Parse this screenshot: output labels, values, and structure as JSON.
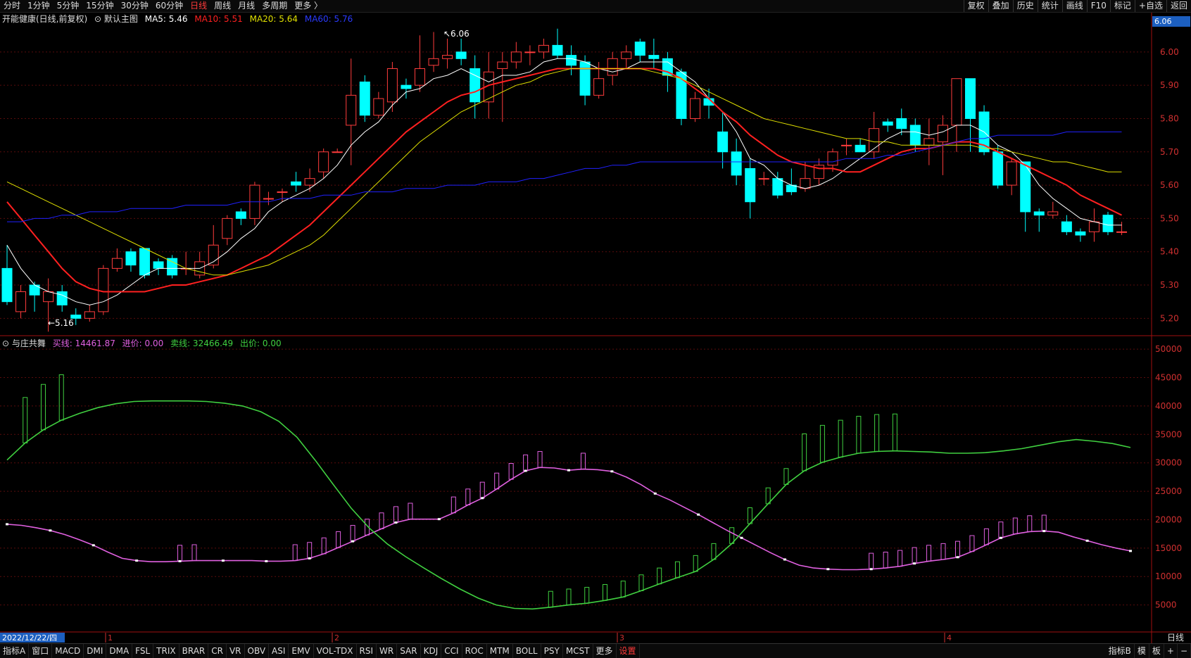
{
  "toolbar": {
    "periods": [
      "分时",
      "1分钟",
      "5分钟",
      "15分钟",
      "30分钟",
      "60分钟",
      "日线",
      "周线",
      "月线",
      "多周期",
      "更多 〉"
    ],
    "active_index": 6,
    "right_items": [
      "复权",
      "叠加",
      "历史",
      "统计",
      "画线",
      "F10",
      "标记",
      "+自选",
      "返回"
    ]
  },
  "main_legend": {
    "title": "开能健康(日线,前复权)",
    "template": "默认主图",
    "ma5": "MA5: 5.46",
    "ma10": "MA10: 5.51",
    "ma20": "MA20: 5.64",
    "ma60": "MA60: 5.76"
  },
  "indicator_legend": {
    "name": "与庄共舞",
    "buy": "买线: 14461.87",
    "in_price": "进价: 0.00",
    "sell": "卖线: 32466.49",
    "out_price": "出价: 0.00"
  },
  "annotations": {
    "high": "6.06",
    "low": "5.16",
    "current_price": "6.06",
    "date_label": "2022/12/22/四"
  },
  "colors": {
    "up": "#ff3c3c",
    "down": "#00ffff",
    "ma5": "#ffffff",
    "ma10": "#ff2020",
    "ma20": "#e0e000",
    "ma60": "#2020ff",
    "buy_line": "#e060e0",
    "sell_line": "#40d040",
    "axis": "#a01010"
  },
  "chart_data": [
    {
      "type": "candlestick",
      "title": "开能健康(日线,前复权)",
      "y_ticks": [
        "6.00",
        "5.90",
        "5.80",
        "5.70",
        "5.60",
        "5.50",
        "5.40",
        "5.30",
        "5.20"
      ],
      "ylim": [
        5.15,
        6.08
      ],
      "x_month_markers": [
        "1",
        "2",
        "3",
        "4"
      ],
      "candles": [
        [
          5.35,
          5.25,
          5.42,
          5.24
        ],
        [
          5.22,
          5.28,
          5.3,
          5.2
        ],
        [
          5.3,
          5.27,
          5.31,
          5.22
        ],
        [
          5.25,
          5.28,
          5.32,
          5.16
        ],
        [
          5.28,
          5.24,
          5.3,
          5.22
        ],
        [
          5.21,
          5.2,
          5.23,
          5.18
        ],
        [
          5.2,
          5.22,
          5.24,
          5.19
        ],
        [
          5.22,
          5.35,
          5.36,
          5.21
        ],
        [
          5.35,
          5.38,
          5.41,
          5.34
        ],
        [
          5.4,
          5.36,
          5.41,
          5.34
        ],
        [
          5.41,
          5.33,
          5.41,
          5.32
        ],
        [
          5.37,
          5.35,
          5.38,
          5.33
        ],
        [
          5.38,
          5.33,
          5.39,
          5.32
        ],
        [
          5.35,
          5.35,
          5.4,
          5.33
        ],
        [
          5.33,
          5.37,
          5.4,
          5.32
        ],
        [
          5.36,
          5.42,
          5.48,
          5.35
        ],
        [
          5.44,
          5.5,
          5.51,
          5.42
        ],
        [
          5.52,
          5.5,
          5.53,
          5.48
        ],
        [
          5.5,
          5.6,
          5.61,
          5.48
        ],
        [
          5.56,
          5.56,
          5.58,
          5.54
        ],
        [
          5.58,
          5.58,
          5.59,
          5.55
        ],
        [
          5.61,
          5.6,
          5.64,
          5.58
        ],
        [
          5.6,
          5.62,
          5.65,
          5.58
        ],
        [
          5.64,
          5.7,
          5.71,
          5.62
        ],
        [
          5.7,
          5.7,
          5.71,
          5.7
        ],
        [
          5.78,
          5.87,
          5.98,
          5.66
        ],
        [
          5.91,
          5.81,
          5.93,
          5.79
        ],
        [
          5.81,
          5.86,
          5.88,
          5.8
        ],
        [
          5.85,
          5.95,
          5.97,
          5.82
        ],
        [
          5.9,
          5.89,
          5.92,
          5.86
        ],
        [
          5.9,
          5.95,
          6.05,
          5.88
        ],
        [
          5.96,
          5.98,
          6.06,
          5.94
        ],
        [
          5.98,
          5.99,
          6.04,
          5.95
        ],
        [
          6.0,
          5.98,
          6.04,
          5.96
        ],
        [
          5.95,
          5.85,
          5.99,
          5.8
        ],
        [
          5.85,
          5.94,
          6.0,
          5.8
        ],
        [
          5.95,
          5.97,
          6.0,
          5.79
        ],
        [
          5.97,
          6.0,
          6.03,
          5.95
        ],
        [
          6.0,
          6.0,
          6.02,
          5.96
        ],
        [
          6.0,
          6.02,
          6.04,
          5.98
        ],
        [
          6.02,
          5.99,
          6.07,
          5.98
        ],
        [
          5.99,
          5.96,
          6.02,
          5.93
        ],
        [
          5.97,
          5.87,
          5.99,
          5.84
        ],
        [
          5.87,
          5.92,
          5.97,
          5.86
        ],
        [
          5.93,
          5.98,
          6.0,
          5.9
        ],
        [
          5.98,
          6.0,
          6.02,
          5.95
        ],
        [
          6.03,
          5.99,
          6.04,
          5.97
        ],
        [
          5.99,
          5.98,
          6.04,
          5.95
        ],
        [
          5.98,
          5.93,
          6.0,
          5.88
        ],
        [
          5.94,
          5.8,
          5.95,
          5.78
        ],
        [
          5.8,
          5.86,
          5.88,
          5.79
        ],
        [
          5.86,
          5.84,
          5.89,
          5.8
        ],
        [
          5.76,
          5.7,
          5.82,
          5.65
        ],
        [
          5.7,
          5.63,
          5.74,
          5.6
        ],
        [
          5.65,
          5.55,
          5.68,
          5.5
        ],
        [
          5.62,
          5.62,
          5.64,
          5.6
        ],
        [
          5.62,
          5.57,
          5.64,
          5.56
        ],
        [
          5.6,
          5.58,
          5.65,
          5.57
        ],
        [
          5.59,
          5.62,
          5.67,
          5.58
        ],
        [
          5.62,
          5.66,
          5.68,
          5.6
        ],
        [
          5.66,
          5.7,
          5.71,
          5.64
        ],
        [
          5.72,
          5.72,
          5.74,
          5.69
        ],
        [
          5.72,
          5.7,
          5.74,
          5.7
        ],
        [
          5.7,
          5.77,
          5.82,
          5.68
        ],
        [
          5.79,
          5.78,
          5.8,
          5.76
        ],
        [
          5.8,
          5.77,
          5.83,
          5.75
        ],
        [
          5.78,
          5.72,
          5.8,
          5.7
        ],
        [
          5.72,
          5.74,
          5.8,
          5.66
        ],
        [
          5.73,
          5.78,
          5.81,
          5.63
        ],
        [
          5.78,
          5.92,
          5.92,
          5.7
        ],
        [
          5.92,
          5.8,
          5.92,
          5.7
        ],
        [
          5.82,
          5.7,
          5.84,
          5.69
        ],
        [
          5.7,
          5.6,
          5.72,
          5.59
        ],
        [
          5.6,
          5.67,
          5.68,
          5.57
        ],
        [
          5.67,
          5.52,
          5.67,
          5.46
        ],
        [
          5.52,
          5.51,
          5.53,
          5.46
        ],
        [
          5.51,
          5.52,
          5.55,
          5.5
        ],
        [
          5.49,
          5.46,
          5.51,
          5.45
        ],
        [
          5.46,
          5.45,
          5.47,
          5.43
        ],
        [
          5.46,
          5.49,
          5.53,
          5.43
        ],
        [
          5.51,
          5.46,
          5.52,
          5.45
        ],
        [
          5.46,
          5.46,
          5.49,
          5.45
        ]
      ],
      "series": [
        {
          "name": "MA5",
          "values": [
            5.42,
            5.35,
            5.3,
            5.28,
            5.27,
            5.25,
            5.24,
            5.25,
            5.27,
            5.3,
            5.33,
            5.35,
            5.35,
            5.35,
            5.35,
            5.37,
            5.4,
            5.44,
            5.47,
            5.52,
            5.55,
            5.57,
            5.59,
            5.62,
            5.66,
            5.72,
            5.76,
            5.79,
            5.84,
            5.88,
            5.89,
            5.92,
            5.93,
            5.95,
            5.93,
            5.91,
            5.93,
            5.93,
            5.94,
            5.97,
            5.98,
            5.98,
            5.97,
            5.95,
            5.94,
            5.95,
            5.97,
            5.97,
            5.97,
            5.94,
            5.91,
            5.86,
            5.82,
            5.76,
            5.68,
            5.66,
            5.62,
            5.6,
            5.59,
            5.6,
            5.62,
            5.65,
            5.68,
            5.71,
            5.74,
            5.76,
            5.76,
            5.75,
            5.76,
            5.78,
            5.78,
            5.76,
            5.72,
            5.7,
            5.66,
            5.6,
            5.56,
            5.53,
            5.5,
            5.49,
            5.48,
            5.48
          ]
        },
        {
          "name": "MA10",
          "values": [
            5.55,
            5.5,
            5.45,
            5.4,
            5.35,
            5.31,
            5.29,
            5.28,
            5.28,
            5.28,
            5.28,
            5.29,
            5.3,
            5.3,
            5.31,
            5.32,
            5.33,
            5.35,
            5.37,
            5.39,
            5.42,
            5.45,
            5.48,
            5.52,
            5.56,
            5.6,
            5.64,
            5.68,
            5.72,
            5.76,
            5.79,
            5.82,
            5.85,
            5.87,
            5.88,
            5.9,
            5.91,
            5.92,
            5.93,
            5.94,
            5.95,
            5.95,
            5.95,
            5.95,
            5.95,
            5.95,
            5.95,
            5.95,
            5.94,
            5.92,
            5.89,
            5.86,
            5.82,
            5.79,
            5.75,
            5.72,
            5.69,
            5.67,
            5.66,
            5.65,
            5.65,
            5.64,
            5.64,
            5.66,
            5.68,
            5.7,
            5.71,
            5.71,
            5.72,
            5.73,
            5.73,
            5.72,
            5.7,
            5.68,
            5.66,
            5.64,
            5.62,
            5.6,
            5.57,
            5.55,
            5.53,
            5.51
          ]
        },
        {
          "name": "MA20",
          "values": [
            5.61,
            5.59,
            5.57,
            5.55,
            5.53,
            5.51,
            5.49,
            5.47,
            5.45,
            5.43,
            5.41,
            5.39,
            5.37,
            5.35,
            5.34,
            5.33,
            5.33,
            5.34,
            5.35,
            5.36,
            5.38,
            5.4,
            5.42,
            5.45,
            5.49,
            5.53,
            5.57,
            5.61,
            5.65,
            5.69,
            5.73,
            5.76,
            5.79,
            5.82,
            5.84,
            5.86,
            5.88,
            5.9,
            5.91,
            5.93,
            5.94,
            5.95,
            5.95,
            5.95,
            5.95,
            5.95,
            5.95,
            5.94,
            5.93,
            5.92,
            5.9,
            5.88,
            5.86,
            5.84,
            5.82,
            5.8,
            5.79,
            5.78,
            5.77,
            5.76,
            5.75,
            5.74,
            5.74,
            5.73,
            5.73,
            5.72,
            5.72,
            5.72,
            5.72,
            5.72,
            5.72,
            5.71,
            5.71,
            5.7,
            5.69,
            5.68,
            5.67,
            5.67,
            5.66,
            5.65,
            5.64,
            5.64
          ]
        },
        {
          "name": "MA60",
          "values": [
            5.49,
            5.49,
            5.5,
            5.5,
            5.51,
            5.51,
            5.52,
            5.52,
            5.52,
            5.53,
            5.53,
            5.53,
            5.53,
            5.54,
            5.54,
            5.54,
            5.54,
            5.55,
            5.55,
            5.55,
            5.56,
            5.56,
            5.56,
            5.57,
            5.57,
            5.57,
            5.58,
            5.58,
            5.58,
            5.59,
            5.59,
            5.59,
            5.6,
            5.6,
            5.6,
            5.61,
            5.61,
            5.61,
            5.62,
            5.62,
            5.63,
            5.64,
            5.65,
            5.65,
            5.66,
            5.66,
            5.67,
            5.67,
            5.67,
            5.67,
            5.67,
            5.67,
            5.67,
            5.67,
            5.67,
            5.67,
            5.67,
            5.67,
            5.67,
            5.67,
            5.67,
            5.68,
            5.68,
            5.68,
            5.69,
            5.69,
            5.7,
            5.71,
            5.72,
            5.73,
            5.74,
            5.74,
            5.75,
            5.75,
            5.75,
            5.75,
            5.75,
            5.76,
            5.76,
            5.76,
            5.76,
            5.76
          ]
        }
      ]
    },
    {
      "type": "line",
      "title": "与庄共舞",
      "y_ticks": [
        "50000",
        "45000",
        "40000",
        "35000",
        "30000",
        "25000",
        "20000",
        "15000",
        "10000",
        "5000"
      ],
      "ylim": [
        0,
        52000
      ],
      "series": [
        {
          "name": "买线",
          "values": [
            19200,
            19000,
            18600,
            18100,
            17400,
            16500,
            15500,
            14300,
            13200,
            12800,
            12600,
            12600,
            12700,
            12800,
            12800,
            12800,
            12800,
            12800,
            12700,
            12700,
            12800,
            13200,
            14000,
            15100,
            16200,
            17300,
            18400,
            19500,
            20100,
            20100,
            20100,
            21200,
            22600,
            23800,
            25400,
            27100,
            28600,
            29200,
            29100,
            28700,
            28900,
            28800,
            28500,
            27500,
            26200,
            24600,
            23500,
            22200,
            20900,
            19500,
            18100,
            16800,
            15500,
            14200,
            13000,
            12000,
            11500,
            11300,
            11200,
            11200,
            11300,
            11500,
            11800,
            12300,
            12700,
            13000,
            13400,
            14400,
            15600,
            16800,
            17500,
            17900,
            18000,
            17800,
            17000,
            16300,
            15600,
            15000,
            14500
          ]
        },
        {
          "name": "卖线",
          "values": [
            30500,
            33500,
            35800,
            37500,
            38700,
            39700,
            40400,
            40800,
            40900,
            40900,
            40900,
            40800,
            40500,
            40000,
            39000,
            37300,
            34500,
            30500,
            26200,
            22000,
            18500,
            15700,
            13500,
            11500,
            9600,
            7800,
            6200,
            5000,
            4400,
            4300,
            4600,
            5000,
            5300,
            5800,
            6400,
            7500,
            8700,
            9800,
            10900,
            13000,
            15800,
            19300,
            22800,
            26200,
            28600,
            30100,
            31000,
            31700,
            32000,
            32100,
            32000,
            31900,
            31700,
            31700,
            31800,
            32100,
            32500,
            33100,
            33700,
            34100,
            33800,
            33400,
            32700
          ]
        }
      ]
    }
  ],
  "bottom_tabs": [
    "指标A",
    "窗口",
    "MACD",
    "DMI",
    "DMA",
    "FSL",
    "TRIX",
    "BRAR",
    "CR",
    "VR",
    "OBV",
    "ASI",
    "EMV",
    "VOL-TDX",
    "RSI",
    "WR",
    "SAR",
    "KDJ",
    "CCI",
    "ROC",
    "MTM",
    "BOLL",
    "PSY",
    "MCST",
    "更多",
    "设置"
  ],
  "bottom_right": [
    "指标B",
    "模",
    "板",
    "+",
    "−"
  ],
  "period_label": "日线"
}
